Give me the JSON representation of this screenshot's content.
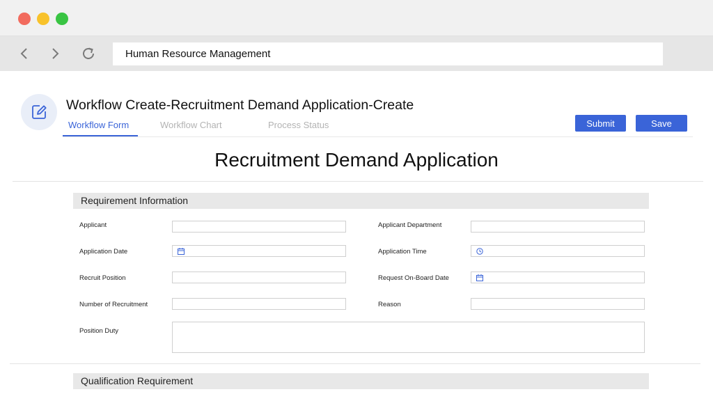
{
  "browser": {
    "address": "Human Resource Management"
  },
  "header": {
    "title": "Workflow Create-Recruitment Demand Application-Create",
    "tabs": [
      "Workflow Form",
      "Workflow Chart",
      "Process Status"
    ],
    "active_tab": "Workflow Form",
    "submit_label": "Submit",
    "save_label": "Save"
  },
  "form": {
    "title": "Recruitment Demand Application",
    "sections": [
      "Requirement Information",
      "Qualification Requirement"
    ],
    "fields": {
      "applicant": {
        "label": "Applicant",
        "value": ""
      },
      "applicant_department": {
        "label": "Applicant Department",
        "value": ""
      },
      "application_date": {
        "label": "Application Date",
        "value": "",
        "icon": "calendar-icon"
      },
      "application_time": {
        "label": "Application Time",
        "value": "",
        "icon": "clock-icon"
      },
      "recruit_position": {
        "label": "Recruit Position",
        "value": ""
      },
      "request_onboard_date": {
        "label": "Request On-Board Date",
        "value": "",
        "icon": "calendar-icon"
      },
      "number_of_recruitment": {
        "label": "Number of Recruitment",
        "value": ""
      },
      "reason": {
        "label": "Reason",
        "value": ""
      },
      "position_duty": {
        "label": "Position Duty",
        "value": ""
      }
    }
  },
  "colors": {
    "accent": "#3a64d8",
    "section_bg": "#e8e8e8",
    "titlebar_bg": "#f1f1f1",
    "navbar_bg": "#e6e6e6",
    "close_dot": "#f26b5e",
    "minimize_dot": "#f8c22b",
    "maximize_dot": "#39c443"
  }
}
